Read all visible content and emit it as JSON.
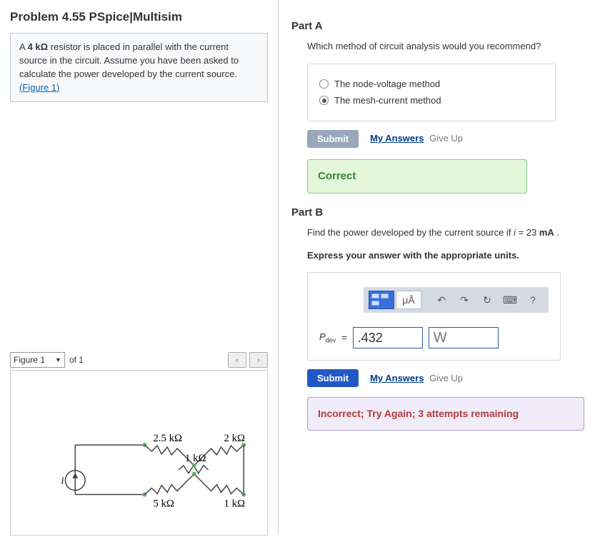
{
  "problem": {
    "title": "Problem 4.55 PSpice|Multisim",
    "intro_pre": "A ",
    "intro_val": "4 kΩ",
    "intro_post": " resistor is placed in parallel with the current source in the circuit. Assume you have been asked to calculate the power developed by the current source.",
    "figure_link": "(Figure 1)"
  },
  "figure": {
    "select_label": "Figure 1",
    "of": "of 1",
    "nav_prev": "‹",
    "nav_next": "›",
    "labels": {
      "r25": "2.5 kΩ",
      "r2": "2 kΩ",
      "r1top": "1 kΩ",
      "r5": "5 kΩ",
      "r1bot": "1 kΩ",
      "i": "i"
    }
  },
  "partA": {
    "title": "Part A",
    "question": "Which method of circuit analysis would you recommend?",
    "opt1": "The node-voltage method",
    "opt2": "The mesh-current method",
    "submit": "Submit",
    "my_answers": "My Answers",
    "give_up": "Give Up",
    "result": "Correct"
  },
  "partB": {
    "title": "Part B",
    "question_pre": "Find the power developed by the current source if ",
    "question_var": "i",
    "question_eq": " = 23 ",
    "question_unit": "mA",
    "hint": "Express your answer with the appropriate units.",
    "muA": "μÅ",
    "undo": "↶",
    "redo": "↷",
    "reset": "↻",
    "keyboard": "⌨",
    "help": "?",
    "pdev_label": "Pdev",
    "eq": "=",
    "value": ".432",
    "unit": "W",
    "submit": "Submit",
    "my_answers": "My Answers",
    "give_up": "Give Up",
    "result": "Incorrect; Try Again; 3 attempts remaining"
  }
}
